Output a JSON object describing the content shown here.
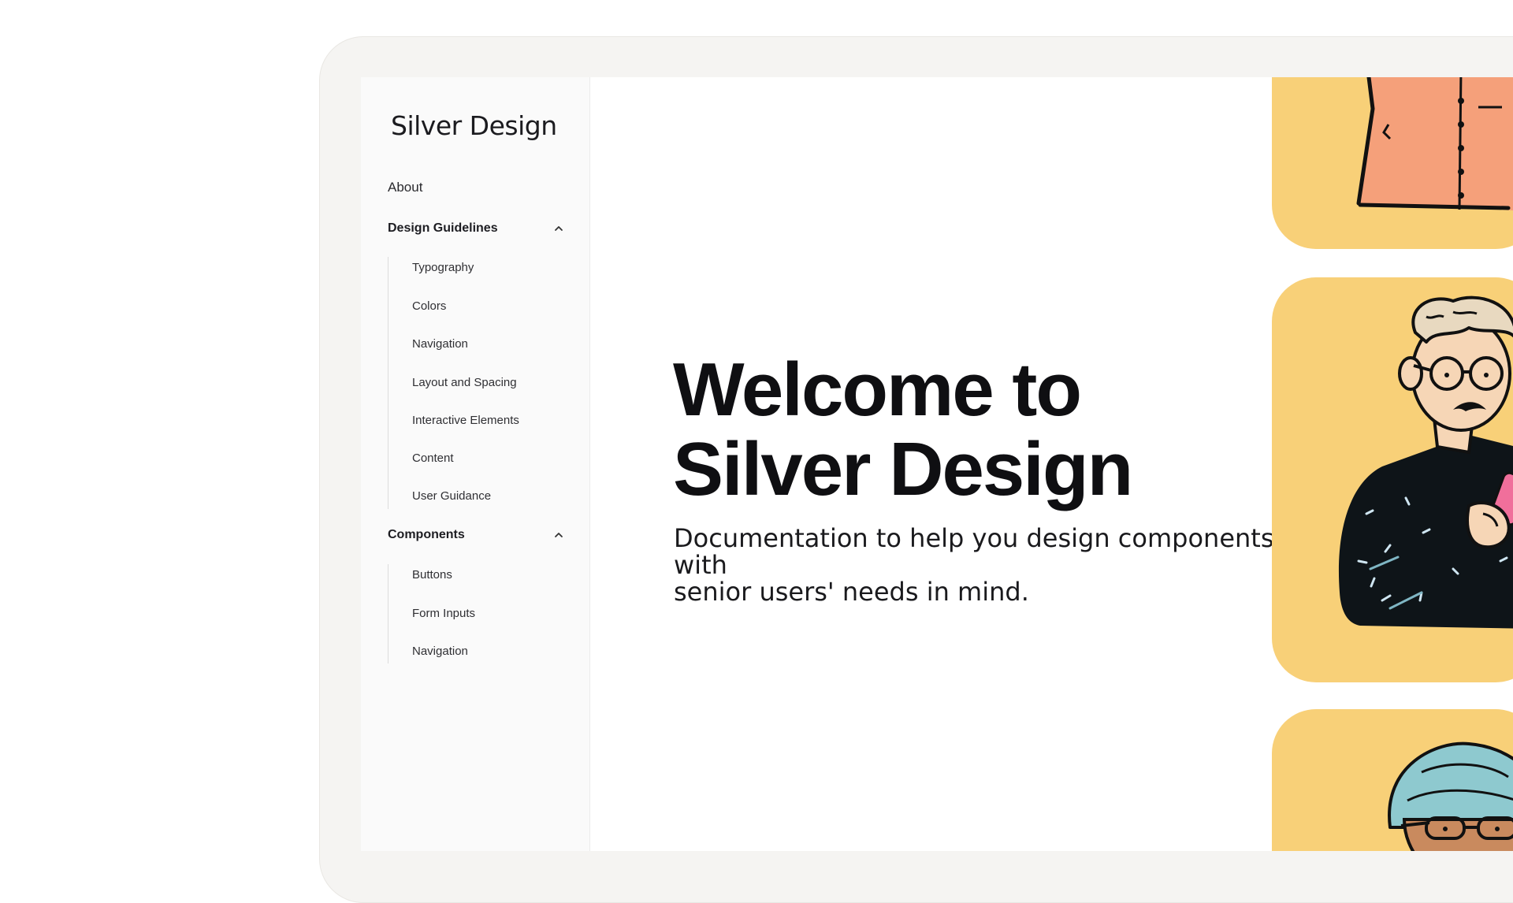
{
  "sidebar": {
    "logo": "Silver Design",
    "about": "About",
    "sections": [
      {
        "title": "Design Guidelines",
        "items": [
          "Typography",
          "Colors",
          "Navigation",
          "Layout and Spacing",
          "Interactive Elements",
          "Content",
          "User Guidance"
        ]
      },
      {
        "title": "Components",
        "items": [
          "Buttons",
          "Form Inputs",
          "Navigation"
        ]
      }
    ]
  },
  "hero": {
    "title_line1": "Welcome to",
    "title_line2": "Silver Design",
    "subtitle_line1": "Documentation to help you design components with",
    "subtitle_line2": "senior users' needs in mind."
  },
  "colors": {
    "card_background": "#f8d078",
    "shirt": "#f5a07a",
    "sweater": "#0e1418",
    "skin": "#f6d6b6",
    "turban": "#8ec9cf"
  },
  "icons": [
    "chevron-up-icon"
  ],
  "illustrations": [
    "illustration-orange-shirt",
    "illustration-older-man-with-phone",
    "illustration-man-with-turban"
  ]
}
